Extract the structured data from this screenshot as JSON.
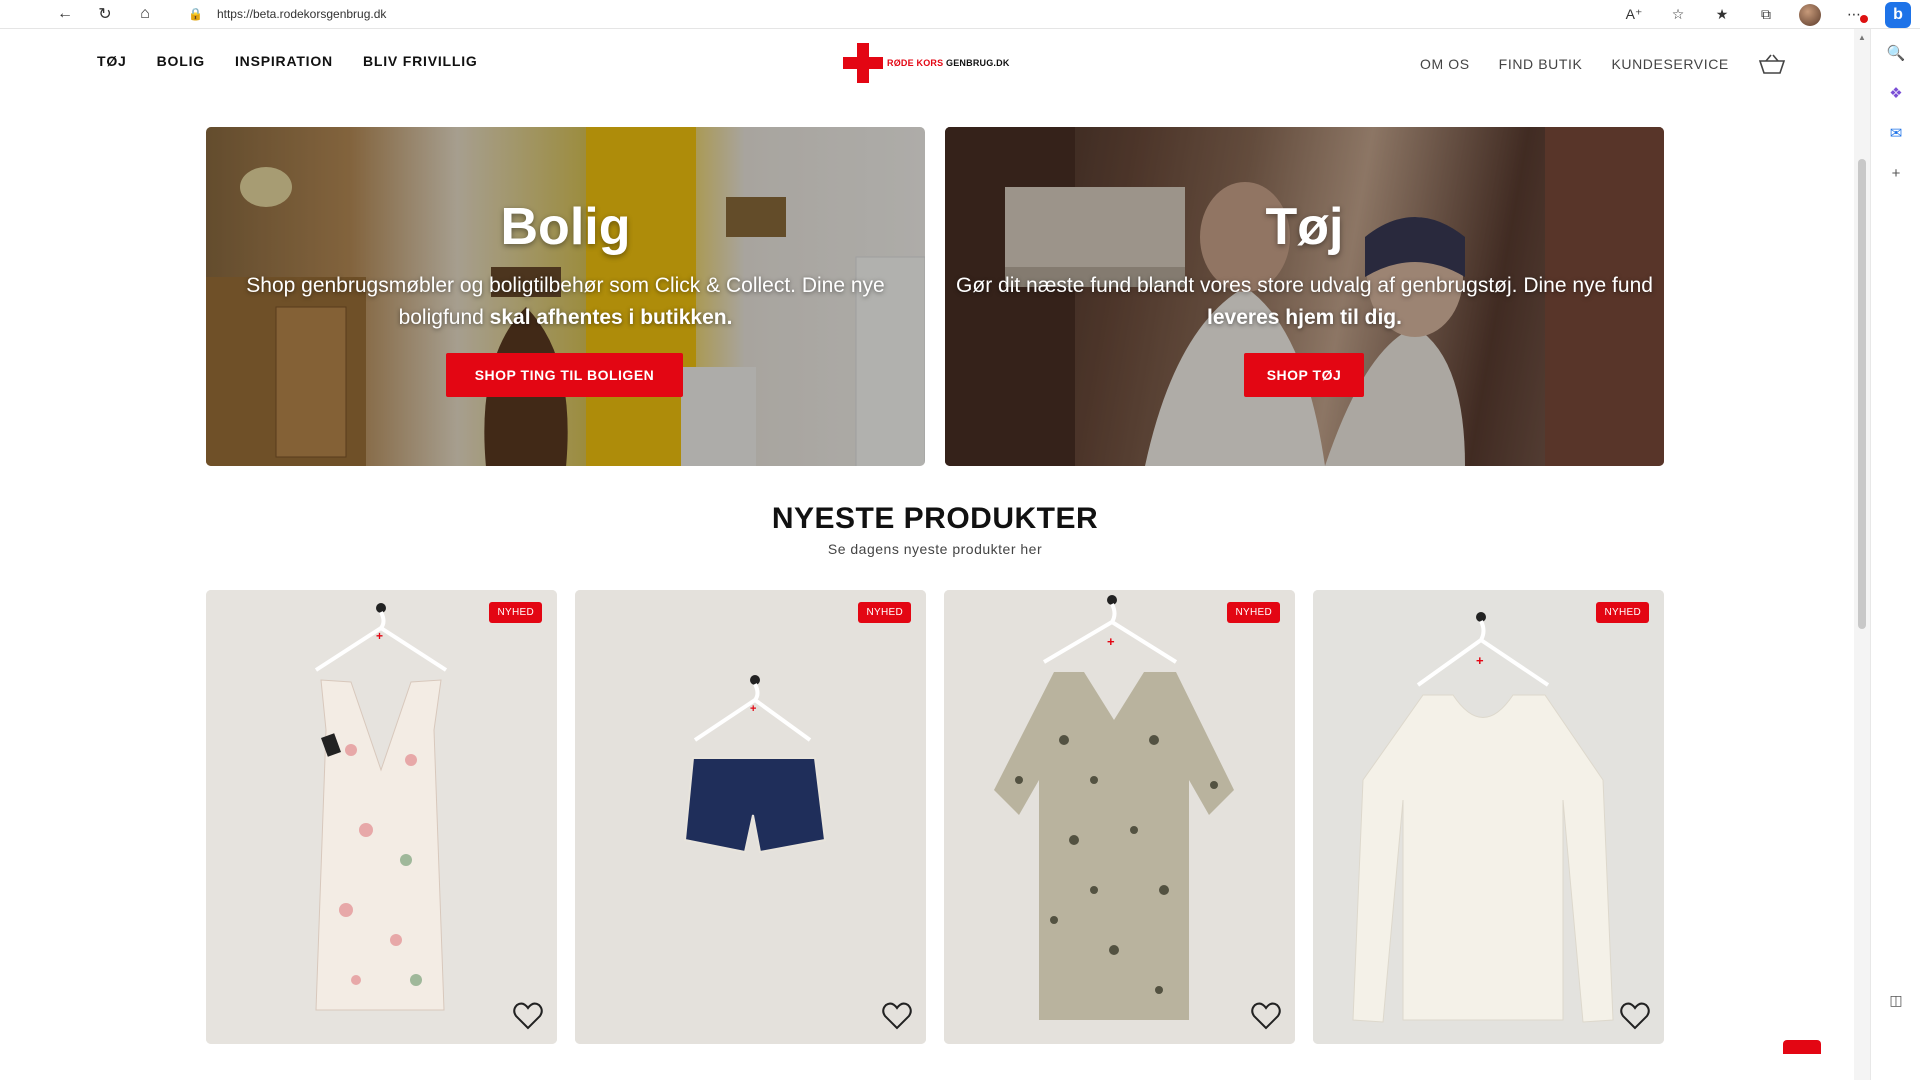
{
  "browser": {
    "url": "https://beta.rodekorsgenbrug.dk",
    "icons": [
      "back-icon",
      "refresh-icon",
      "home-icon",
      "lock-icon",
      "read-aloud-icon",
      "favorite-icon",
      "favorites-bar-icon",
      "collections-icon",
      "profile-avatar",
      "more-icon",
      "bing-icon"
    ]
  },
  "header": {
    "nav": [
      "TØJ",
      "BOLIG",
      "INSPIRATION",
      "BLIV FRIVILLIG"
    ],
    "logo_red": "RØDE KORS",
    "logo_black": "GENBRUG.DK",
    "util": [
      "OM OS",
      "FIND BUTIK",
      "KUNDESERVICE"
    ]
  },
  "heroes": {
    "bolig": {
      "title": "Bolig",
      "text_plain": "Shop genbrugsmøbler og boligtilbehør som Click & Collect. Dine nye boligfund ",
      "text_bold": "skal afhentes i butikken.",
      "button": "SHOP TING TIL BOLIGEN"
    },
    "toj": {
      "title": "Tøj",
      "text_plain": "Gør dit næste fund blandt vores store udvalg af genbrugstøj. Dine nye fund ",
      "text_bold": "leveres hjem til dig.",
      "button": "SHOP TØJ"
    }
  },
  "section": {
    "title": "NYESTE PRODUKTER",
    "subtitle": "Se dagens nyeste produkter her"
  },
  "products": [
    {
      "badge": "NYHED",
      "garment": "floral-dress"
    },
    {
      "badge": "NYHED",
      "garment": "navy-shorts"
    },
    {
      "badge": "NYHED",
      "garment": "patterned-blouse"
    },
    {
      "badge": "NYHED",
      "garment": "white-longsleeve"
    }
  ],
  "colors": {
    "brand_red": "#e30613"
  }
}
